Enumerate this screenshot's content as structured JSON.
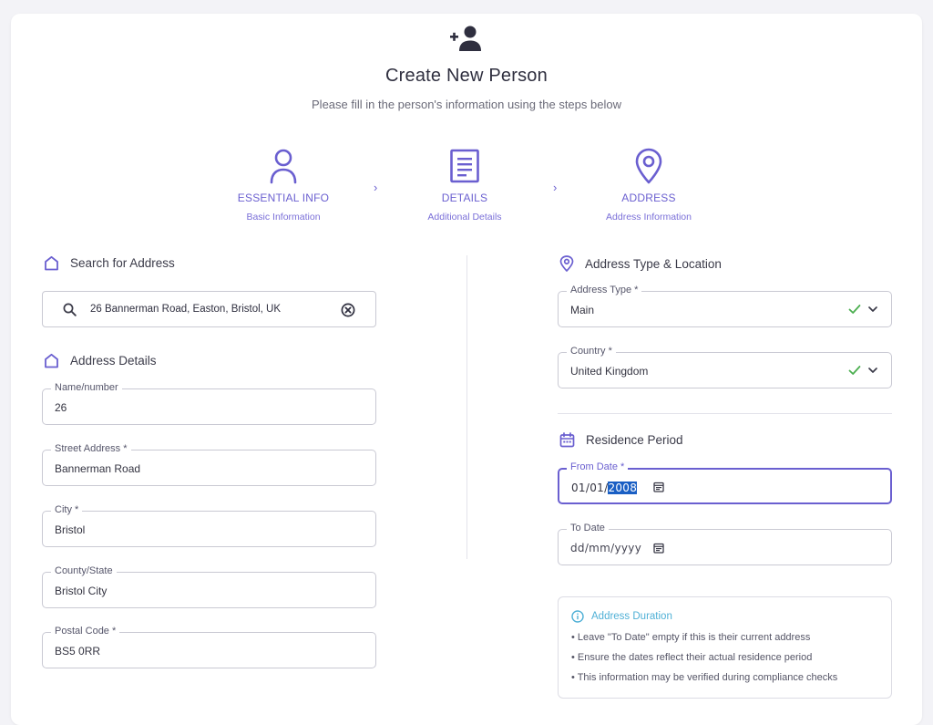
{
  "header": {
    "icon": "add-person-icon",
    "title": "Create New Person",
    "subtitle": "Please fill in the person's information using the steps below"
  },
  "steps": [
    {
      "icon": "person-icon",
      "label": "ESSENTIAL INFO",
      "sub": "Basic Information"
    },
    {
      "icon": "document-icon",
      "label": "DETAILS",
      "sub": "Additional Details"
    },
    {
      "icon": "location-pin-icon",
      "label": "ADDRESS",
      "sub": "Address Information"
    }
  ],
  "left": {
    "search_section": "Search for Address",
    "search_value": "26 Bannerman Road, Easton, Bristol, UK",
    "details_section": "Address Details",
    "fields": [
      {
        "label": "Name/number",
        "value": "26"
      },
      {
        "label": "Street Address *",
        "value": "Bannerman Road"
      },
      {
        "label": "City *",
        "value": "Bristol"
      },
      {
        "label": "County/State",
        "value": "Bristol City"
      },
      {
        "label": "Postal Code *",
        "value": "BS5 0RR"
      }
    ]
  },
  "right": {
    "type_section": "Address Type & Location",
    "address_type": {
      "label": "Address Type *",
      "value": "Main"
    },
    "country": {
      "label": "Country *",
      "value": "United Kingdom"
    },
    "period_section": "Residence Period",
    "from_date": {
      "label": "From Date *",
      "day_month": "01/01/",
      "year": "2008"
    },
    "to_date": {
      "label": "To Date",
      "placeholder": "dd/mm/yyyy"
    }
  },
  "info": {
    "title": "Address Duration",
    "items": [
      "• Leave \"To Date\" empty if this is their current address",
      "• Ensure the dates reflect their actual residence period",
      "• This information may be verified during compliance checks"
    ]
  },
  "colors": {
    "accent": "#6a5fd0",
    "success": "#4caf50",
    "info": "#4fb0d6",
    "selection": "#1a5fc4"
  }
}
